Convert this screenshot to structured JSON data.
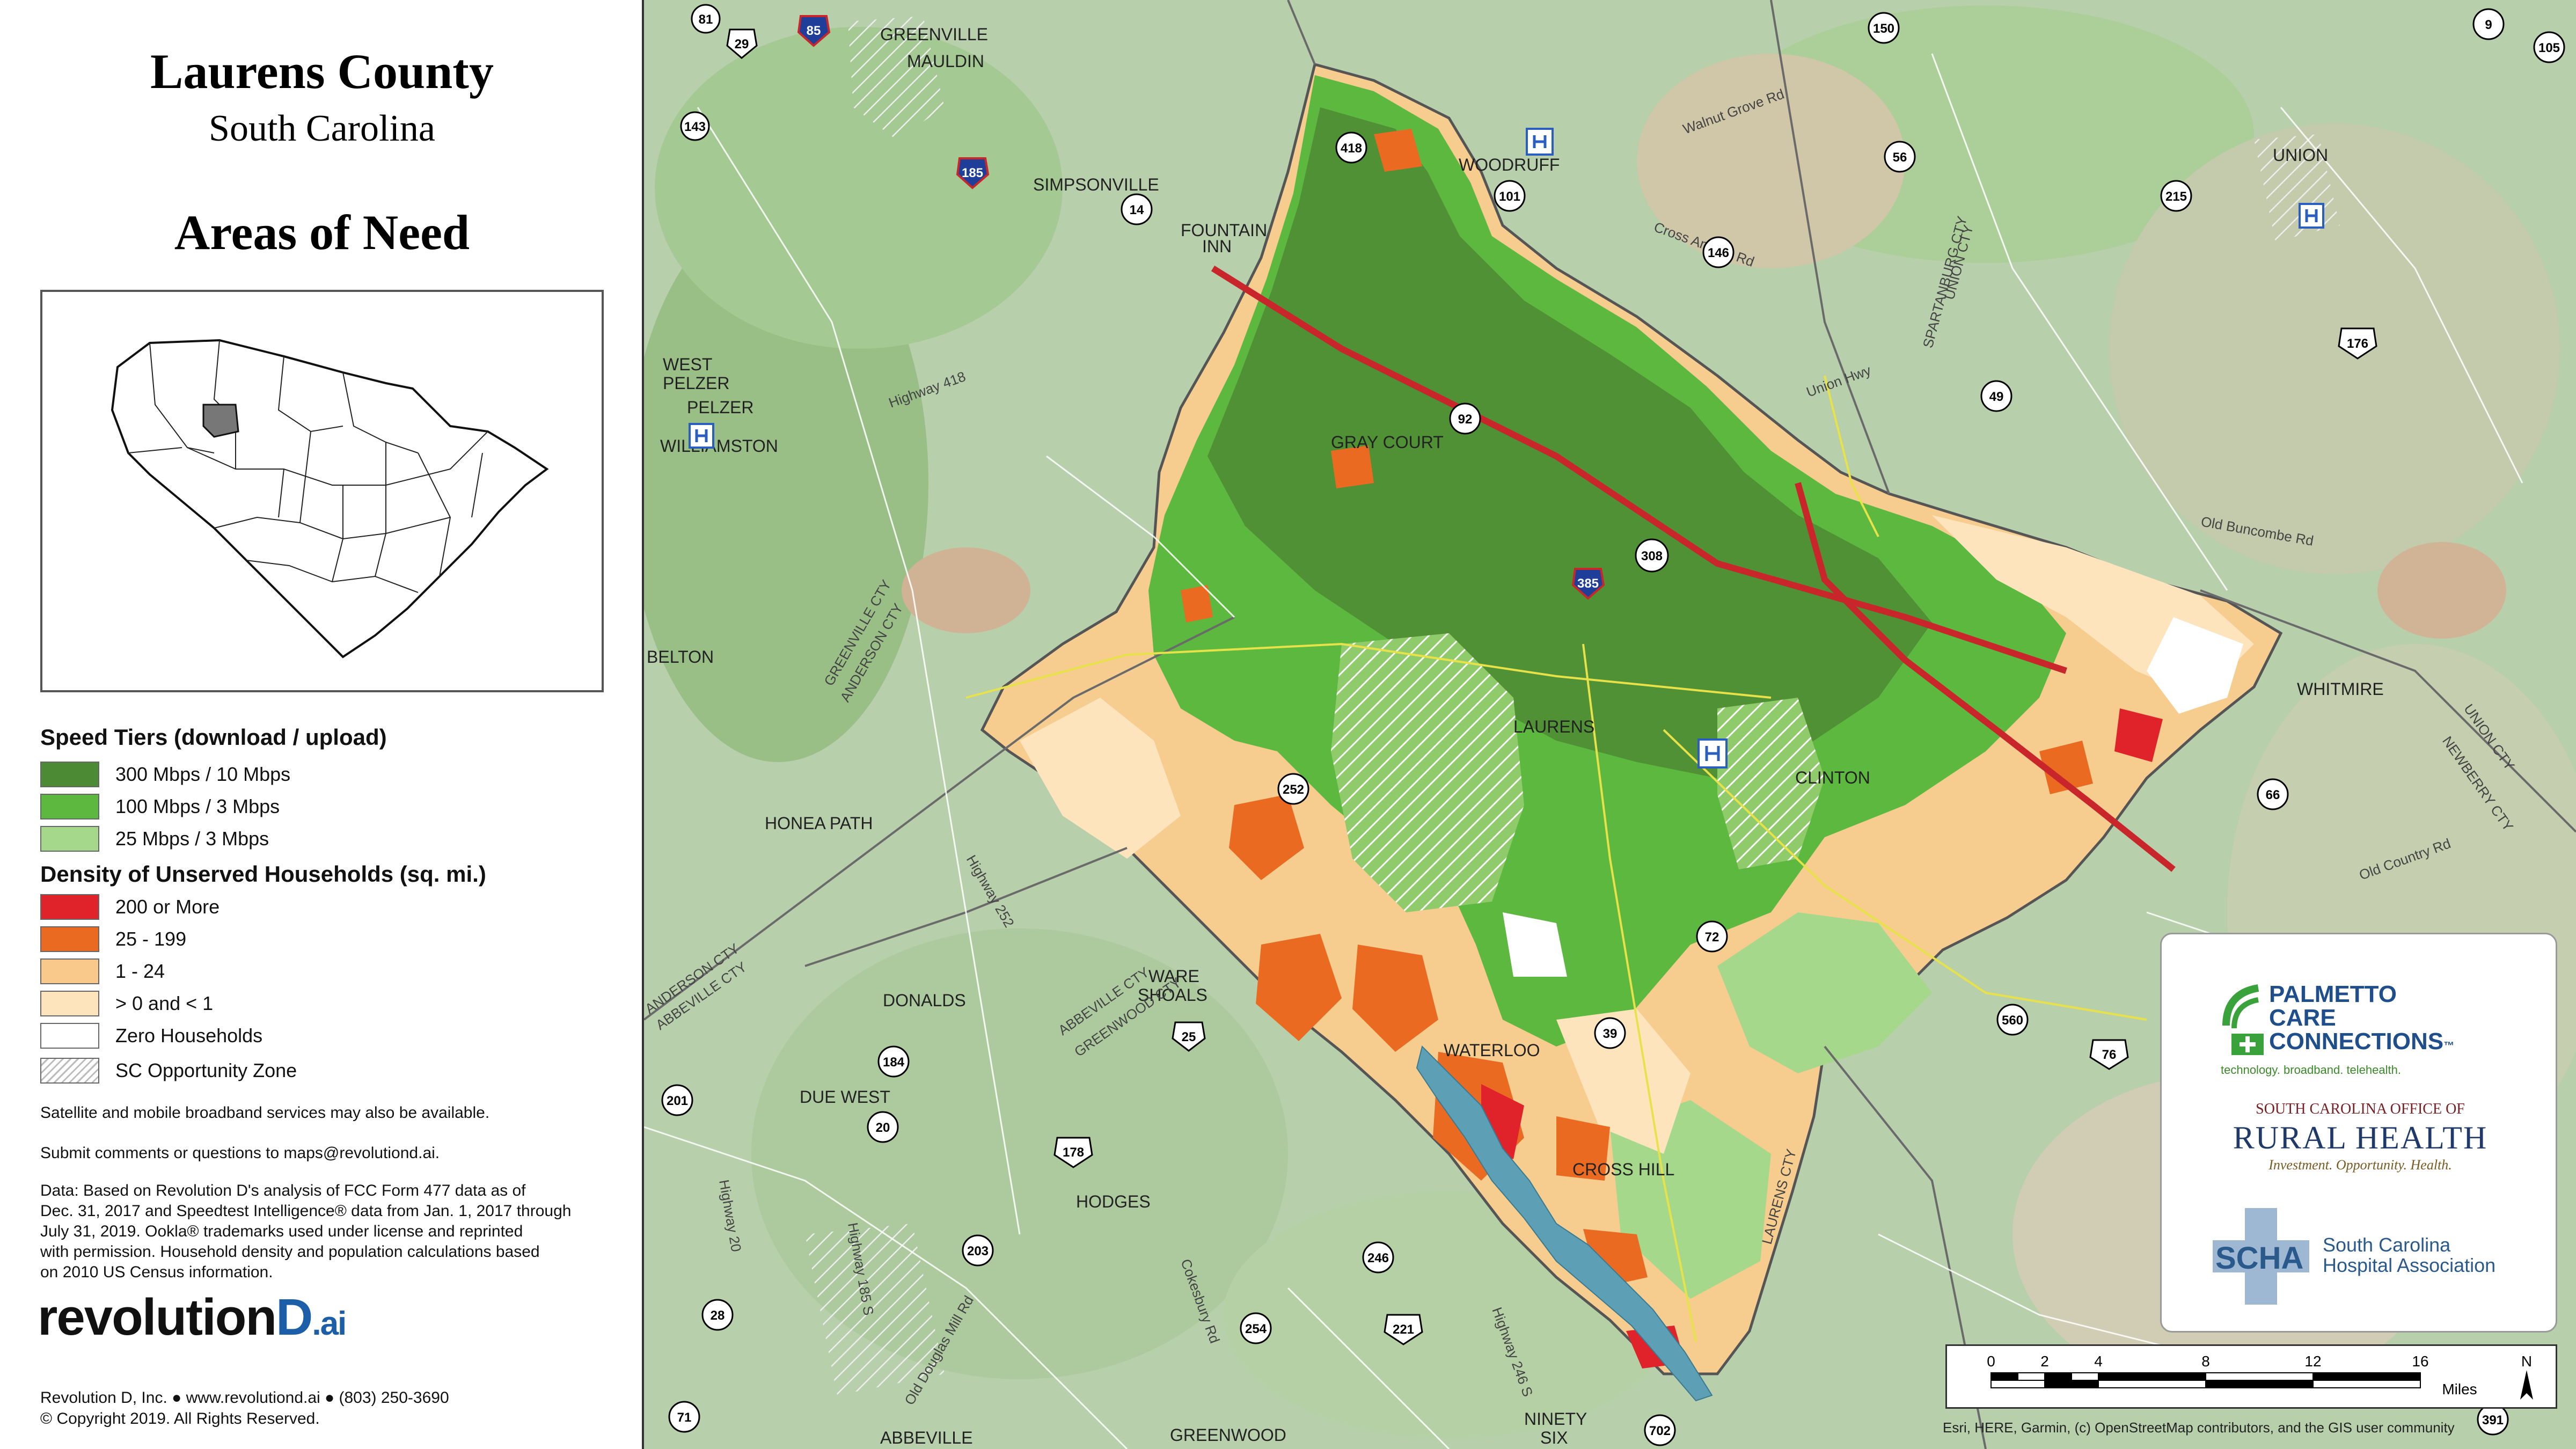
{
  "title": {
    "county": "Laurens County",
    "state": "South Carolina",
    "subtitle": "Areas of Need"
  },
  "legend": {
    "speed_heading": "Speed Tiers (download / upload)",
    "speed_tiers": [
      {
        "label": "300 Mbps / 10 Mbps",
        "color": "#4c8a33"
      },
      {
        "label": "100 Mbps / 3 Mbps",
        "color": "#5cb83e"
      },
      {
        "label": "25 Mbps / 3 Mbps",
        "color": "#a5d88a"
      }
    ],
    "density_heading": "Density of Unserved Households (sq. mi.)",
    "density_tiers": [
      {
        "label": "200 or More",
        "color": "#e0222a"
      },
      {
        "label": "25 - 199",
        "color": "#ea6a22"
      },
      {
        "label": "1 - 24",
        "color": "#f8c98a"
      },
      {
        "label": "> 0 and < 1",
        "color": "#fde4bd"
      },
      {
        "label": "Zero Households",
        "color": "#ffffff"
      },
      {
        "label": "SC Opportunity Zone",
        "color": "hatch"
      }
    ]
  },
  "notes": {
    "satellite": "Satellite and mobile broadband services may also be available.",
    "comments": "Submit comments or questions to maps@revolutiond.ai.",
    "data_line1": "Data: Based on Revolution D's analysis of FCC Form 477 data as of",
    "data_line2": "Dec. 31, 2017 and Speedtest Intelligence® data from Jan. 1, 2017 through",
    "data_line3": "July 31, 2019. Ookla® trademarks used under license and reprinted",
    "data_line4": "with permission.  Household density and population calculations based",
    "data_line5": "on 2010 US Census information."
  },
  "logo": {
    "word": "revolution",
    "letter": "D",
    "suffix": ".ai"
  },
  "footer": {
    "contact": "Revolution D, Inc. ● www.revolutiond.ai ● (803) 250-3690",
    "copyright": "© Copyright 2019. All Rights Reserved."
  },
  "map": {
    "places": [
      {
        "name": "GREENVILLE"
      },
      {
        "name": "MAULDIN"
      },
      {
        "name": "SIMPSONVILLE"
      },
      {
        "name": "FOUNTAIN"
      },
      {
        "name": "INN"
      },
      {
        "name": "WOODRUFF"
      },
      {
        "name": "WEST"
      },
      {
        "name": "PELZER"
      },
      {
        "name": "PELZER"
      },
      {
        "name": "WILLIAMSTON"
      },
      {
        "name": "GRAY COURT"
      },
      {
        "name": "LAURENS"
      },
      {
        "name": "CLINTON"
      },
      {
        "name": "BELTON"
      },
      {
        "name": "HONEA PATH"
      },
      {
        "name": "WARE"
      },
      {
        "name": "SHOALS"
      },
      {
        "name": "DONALDS"
      },
      {
        "name": "WATERLOO"
      },
      {
        "name": "DUE WEST"
      },
      {
        "name": "CROSS HILL"
      },
      {
        "name": "HODGES"
      },
      {
        "name": "UNION"
      },
      {
        "name": "WHITMIRE"
      },
      {
        "name": "GREENWOOD"
      },
      {
        "name": "NINETY"
      },
      {
        "name": "SIX"
      },
      {
        "name": "ABBEVILLE"
      }
    ],
    "county_lines": [
      {
        "name": "GREENVILLE CTY"
      },
      {
        "name": "ANDERSON CTY"
      },
      {
        "name": "SPARTANBURG CTY"
      },
      {
        "name": "UNION CTY"
      },
      {
        "name": "NEWBERRY CTY"
      },
      {
        "name": "UNION CTY"
      },
      {
        "name": "ABBEVILLE CTY"
      },
      {
        "name": "GREENWOOD CTY"
      },
      {
        "name": "ANDERSON CTY"
      },
      {
        "name": "ABBEVILLE CTY"
      },
      {
        "name": "LAURENS CTY"
      }
    ],
    "roads": [
      {
        "name": "Highway 418"
      },
      {
        "name": "Highway 252"
      },
      {
        "name": "Highway 20"
      },
      {
        "name": "Highway 185 S"
      },
      {
        "name": "Highway 246 S"
      },
      {
        "name": "Old Buncombe Rd"
      },
      {
        "name": "Old Country Rd"
      },
      {
        "name": "Union Hwy"
      },
      {
        "name": "Cross Anchor Rd"
      },
      {
        "name": "Walnut Grove Rd"
      },
      {
        "name": "Old Douglas Mill Rd"
      },
      {
        "name": "Cokesbury Rd"
      }
    ],
    "route_shields": [
      {
        "num": "81"
      },
      {
        "num": "29"
      },
      {
        "num": "85"
      },
      {
        "num": "143"
      },
      {
        "num": "185"
      },
      {
        "num": "418"
      },
      {
        "num": "14"
      },
      {
        "num": "101"
      },
      {
        "num": "146"
      },
      {
        "num": "150"
      },
      {
        "num": "56"
      },
      {
        "num": "215"
      },
      {
        "num": "9"
      },
      {
        "num": "105"
      },
      {
        "num": "176"
      },
      {
        "num": "49"
      },
      {
        "num": "92"
      },
      {
        "num": "308"
      },
      {
        "num": "385"
      },
      {
        "num": "252"
      },
      {
        "num": "66"
      },
      {
        "num": "72"
      },
      {
        "num": "560"
      },
      {
        "num": "76"
      },
      {
        "num": "39"
      },
      {
        "num": "25"
      },
      {
        "num": "184"
      },
      {
        "num": "20"
      },
      {
        "num": "201"
      },
      {
        "num": "178"
      },
      {
        "num": "203"
      },
      {
        "num": "246"
      },
      {
        "num": "254"
      },
      {
        "num": "221"
      },
      {
        "num": "28"
      },
      {
        "num": "71"
      },
      {
        "num": "702"
      },
      {
        "num": "391"
      }
    ]
  },
  "partners": {
    "pcc_name_line1": "PALMETTO",
    "pcc_name_line2": "CARE",
    "pcc_name_line3": "CONNECTIONS",
    "pcc_tm": "™",
    "pcc_tagline": "technology. broadband. telehealth.",
    "orh_line1": "SOUTH CAROLINA OFFICE OF",
    "orh_line2": "RURAL HEALTH",
    "orh_line3": "Investment. Opportunity. Health.",
    "scha_abbr": "SCHA",
    "scha_name_line1": "South Carolina",
    "scha_name_line2": "Hospital Association"
  },
  "scale": {
    "ticks": [
      "0",
      "2",
      "4",
      "8",
      "12",
      "16"
    ],
    "unit": "Miles",
    "north": "N"
  },
  "attribution": "Esri, HERE, Garmin, (c) OpenStreetMap contributors, and the GIS user community"
}
